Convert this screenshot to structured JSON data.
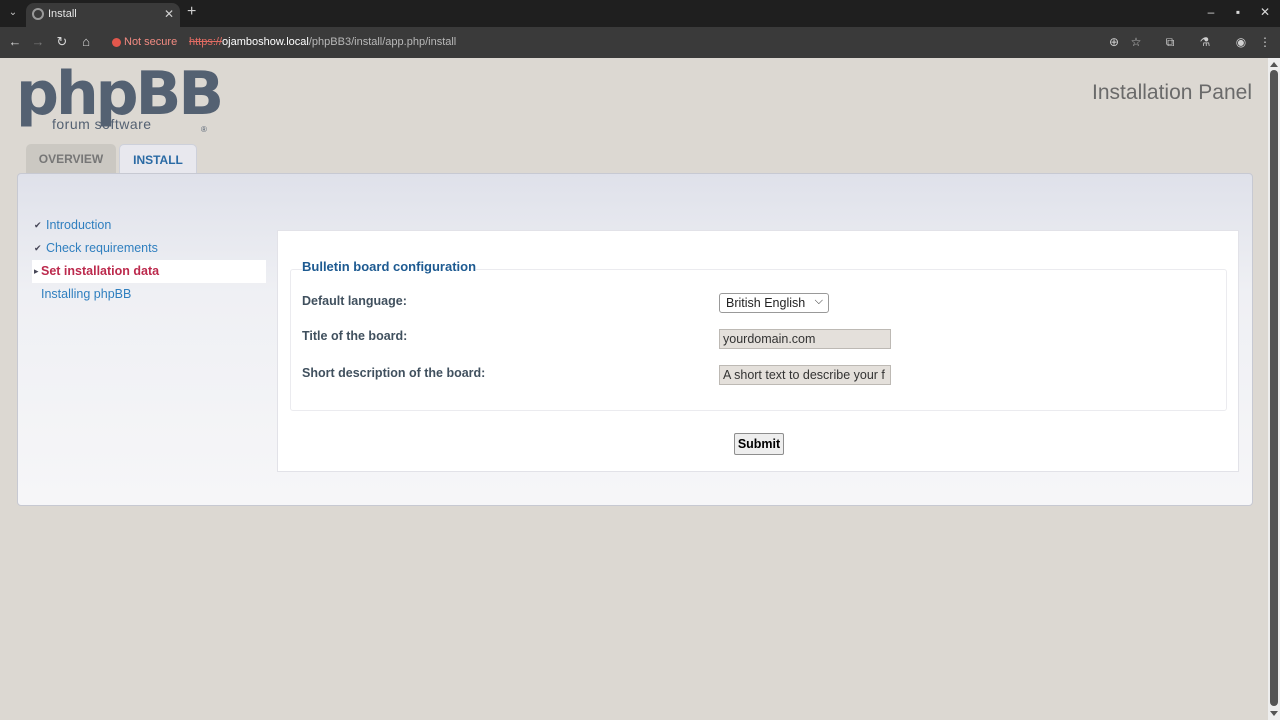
{
  "browser": {
    "tab_title": "Install",
    "tab_close": "✕",
    "new_tab": "+",
    "security_label": "Not secure",
    "url_scheme": "https://",
    "url_host": "ojamboshow.local",
    "url_path": "/phpBB3/install/app.php/install"
  },
  "header": {
    "logo_main": "phpBB",
    "logo_sub": "forum software",
    "logo_reg": "®",
    "panel_title": "Installation Panel"
  },
  "tabs": [
    {
      "label": "OVERVIEW"
    },
    {
      "label": "INSTALL"
    }
  ],
  "sidebar": {
    "items": [
      {
        "label": "Introduction",
        "state": "completed"
      },
      {
        "label": "Check requirements",
        "state": "completed"
      },
      {
        "label": "Set installation data",
        "state": "active"
      },
      {
        "label": "Installing phpBB",
        "state": "pending"
      }
    ]
  },
  "form": {
    "legend": "Bulletin board configuration",
    "default_language_label": "Default language:",
    "default_language_value": "British English",
    "board_title_label": "Title of the board:",
    "board_title_value": "yourdomain.com",
    "board_desc_label": "Short description of the board:",
    "board_desc_value": "A short text to describe your f",
    "submit_label": "Submit"
  },
  "colors": {
    "accent": "#2a6aa4",
    "active_item": "#bc2a4d",
    "legend": "#1d5a91"
  }
}
